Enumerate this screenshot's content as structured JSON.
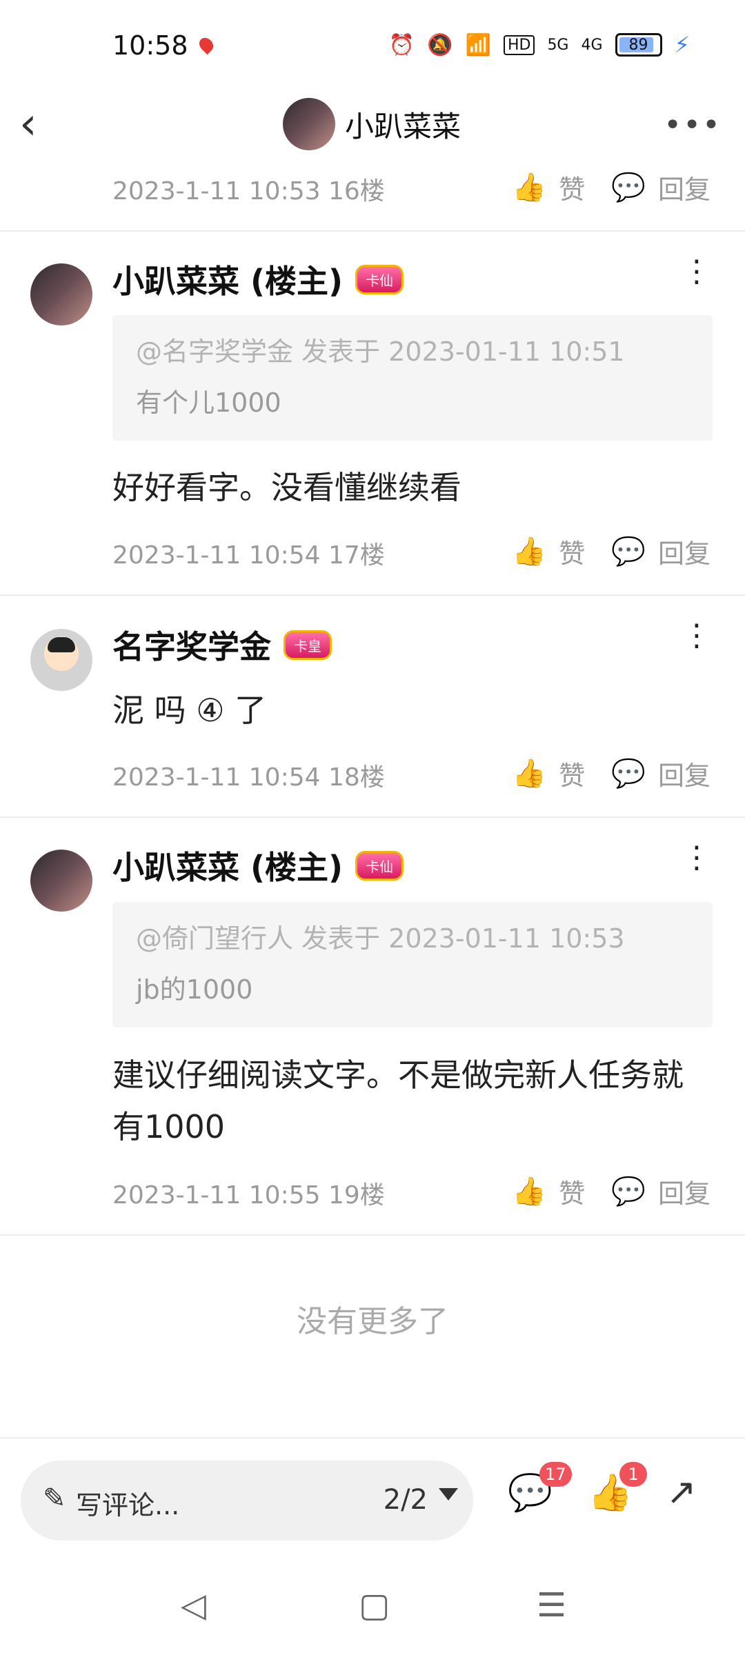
{
  "status_bar": {
    "time": "10:58",
    "icons": [
      "alarm-icon",
      "mute-icon",
      "wifi-icon",
      "hd-icon",
      "signal-5g-icon",
      "signal-4g-icon"
    ],
    "signal_5g": "5G",
    "signal_4g": "4G",
    "hd": "HD",
    "battery": "89"
  },
  "header": {
    "title": "小趴菜菜"
  },
  "posts": [
    {
      "meta": "2023-1-11 10:53  16楼",
      "like": "赞",
      "reply": "回复"
    },
    {
      "author": "小趴菜菜 (楼主)",
      "badge": "卡仙",
      "quote_ref": "@名字奖学金 发表于 2023-01-11 10:51",
      "quote_text": "有个儿1000",
      "content": "好好看字。没看懂继续看",
      "meta": "2023-1-11 10:54  17楼",
      "like": "赞",
      "reply": "回复"
    },
    {
      "author": "名字奖学金",
      "badge": "卡皇",
      "content": "泥 吗 ④ 了",
      "meta": "2023-1-11 10:54  18楼",
      "like": "赞",
      "reply": "回复"
    },
    {
      "author": "小趴菜菜 (楼主)",
      "badge": "卡仙",
      "quote_ref": "@倚门望行人 发表于 2023-01-11 10:53",
      "quote_text": "jb的1000",
      "content": "建议仔细阅读文字。不是做完新人任务就有1000",
      "meta": "2023-1-11 10:55  19楼",
      "like": "赞",
      "reply": "回复"
    }
  ],
  "no_more": "没有更多了",
  "bottom": {
    "comment_placeholder": "写评论...",
    "page": "2/2",
    "comment_count": "17",
    "like_count": "1"
  },
  "colors": {
    "badge_red": "#f0525b",
    "muted_text": "#9a9a9a"
  }
}
